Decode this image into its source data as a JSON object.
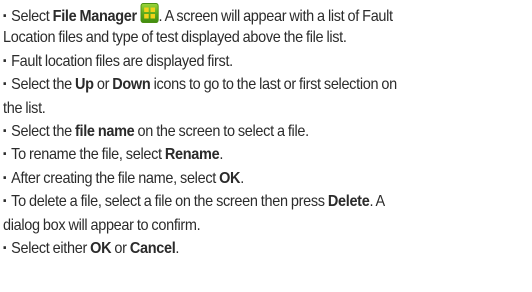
{
  "bullet_glyph": "▪",
  "instructions": [
    {
      "pre": "Select ",
      "bold": "File Manager",
      "mid": "",
      "bold2": "",
      "post": ". A screen will appear with a list of Fault",
      "continuation": "Location files and type of test displayed above the file list.",
      "icon": "file-manager-icon"
    },
    {
      "pre": "Fault location files are displayed first.",
      "bold": "",
      "mid": "",
      "bold2": "",
      "post": "",
      "continuation": ""
    },
    {
      "pre": "Select the ",
      "bold": "Up",
      "mid": " or ",
      "bold2": "Down",
      "post": " icons to go to the last or first selection on",
      "continuation": "the list."
    },
    {
      "pre": "Select the ",
      "bold": "file name",
      "mid": "",
      "bold2": "",
      "post": " on the screen to select a file.",
      "continuation": ""
    },
    {
      "pre": "To rename the file, select ",
      "bold": "Rename",
      "mid": "",
      "bold2": "",
      "post": ".",
      "continuation": ""
    },
    {
      "pre": "After creating the file name, select ",
      "bold": "OK",
      "mid": "",
      "bold2": "",
      "post": ".",
      "continuation": ""
    },
    {
      "pre": "To delete a file, select a file on the screen then press ",
      "bold": "Delete",
      "mid": "",
      "bold2": "",
      "post": ". A",
      "continuation": "dialog box will appear to confirm."
    },
    {
      "pre": "Select either ",
      "bold": "OK",
      "mid": " or ",
      "bold2": "Cancel",
      "post": ".",
      "continuation": ""
    }
  ],
  "colors": {
    "text": "#2b2b2b",
    "icon_green": "#6bbd1f",
    "icon_symbol": "#f2d21b"
  }
}
